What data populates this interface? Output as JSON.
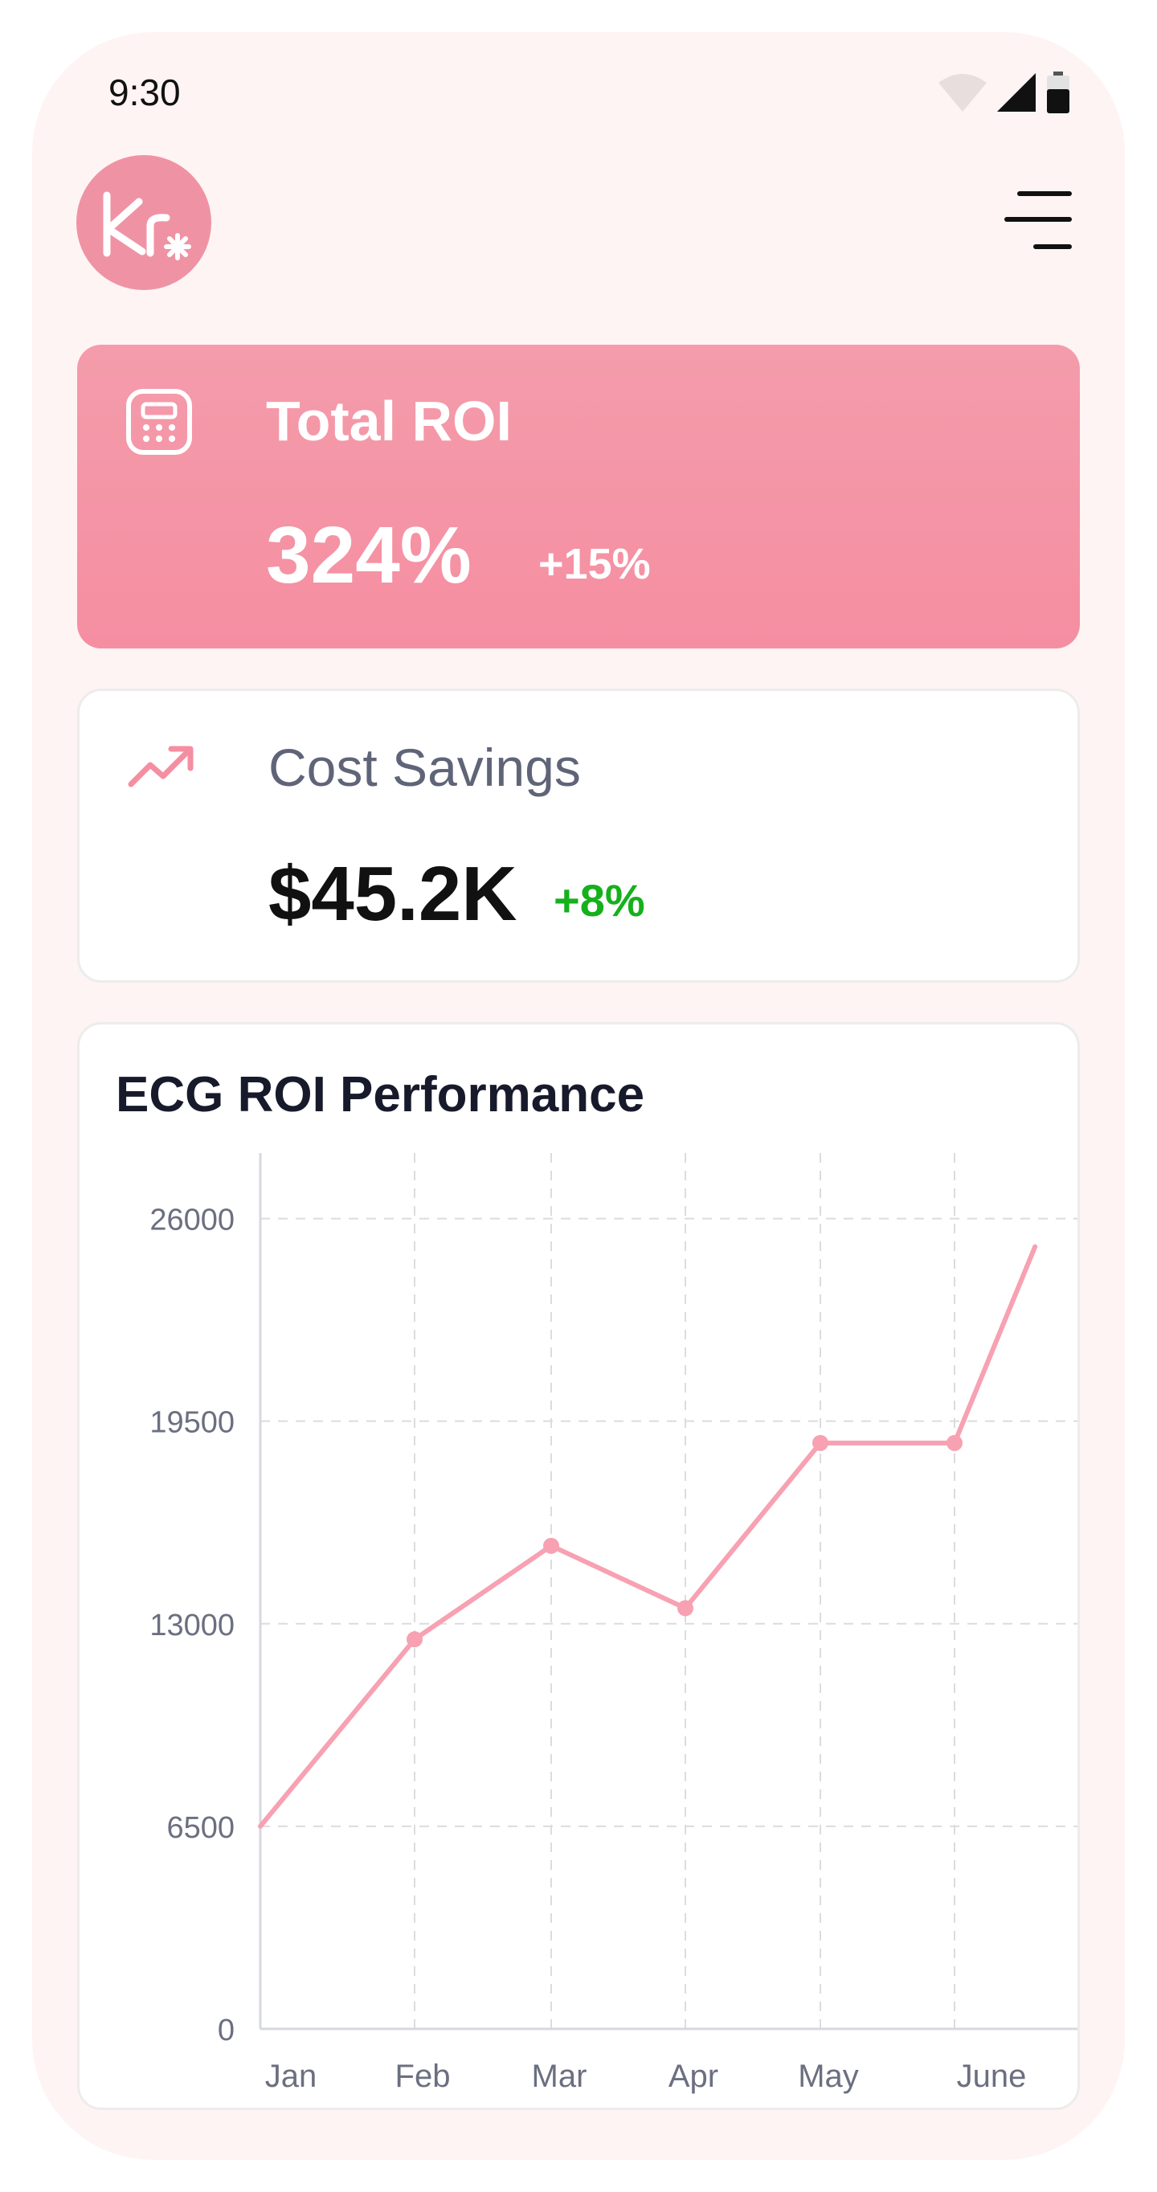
{
  "status_bar": {
    "time": "9:30",
    "icons": [
      "wifi-icon",
      "signal-icon",
      "battery-icon"
    ]
  },
  "header": {
    "logo_icon": "kr-logo-icon",
    "menu_icon": "menu-icon"
  },
  "roi_card": {
    "icon": "calculator-icon",
    "title": "Total ROI",
    "value": "324%",
    "change": "+15%"
  },
  "savings_card": {
    "icon": "trending-up-icon",
    "title": "Cost Savings",
    "value": "$45.2K",
    "change": "+8%"
  },
  "colors": {
    "accent": "#f58ea1",
    "line": "#f7a1b2",
    "positive": "#16b01c"
  },
  "chart_data": {
    "type": "line",
    "title": "ECG ROI Performance",
    "categories": [
      "Jan",
      "Feb",
      "Mar",
      "Apr",
      "May",
      "June"
    ],
    "x_ticks": [
      "Jan",
      "Feb",
      "Mar",
      "Apr",
      "May",
      "June"
    ],
    "y_ticks": [
      "0",
      "6500",
      "13000",
      "19500",
      "26000"
    ],
    "ylim": [
      0,
      28000
    ],
    "grid": true,
    "points": [
      {
        "x": 0,
        "y": 6500
      },
      {
        "x": 1,
        "y": 12500
      },
      {
        "x": 2,
        "y": 15500
      },
      {
        "x": 3,
        "y": 13500
      },
      {
        "x": 4,
        "y": 18800
      },
      {
        "x": 5,
        "y": 18800
      },
      {
        "x": 5.6,
        "y": 25100
      }
    ]
  }
}
